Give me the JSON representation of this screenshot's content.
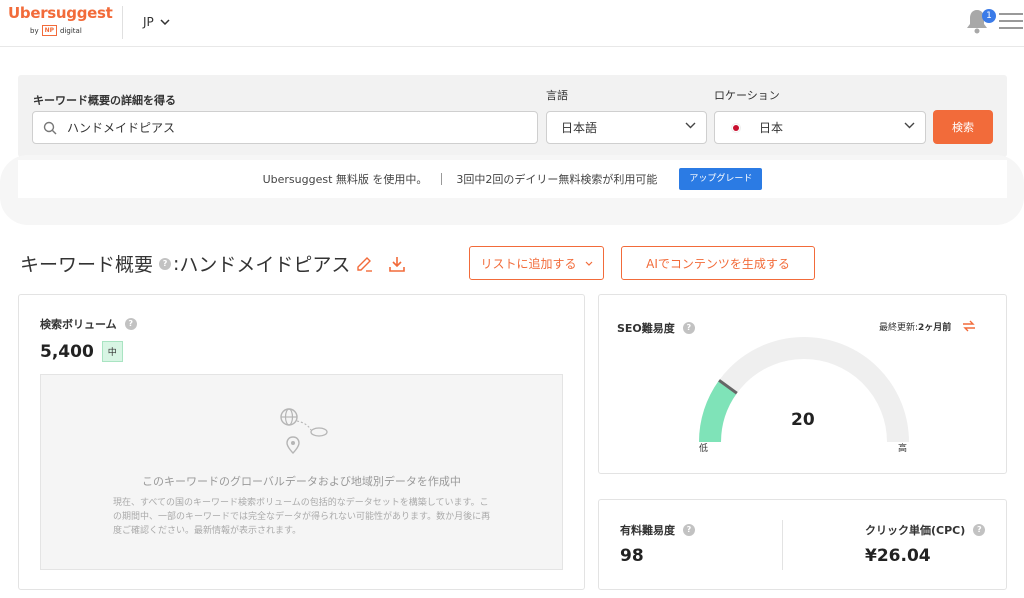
{
  "header": {
    "logo_main": "Ubersuggest",
    "logo_by": "by",
    "logo_np": "NP",
    "logo_digital": "digital",
    "lang_code": "JP",
    "notification_count": "1"
  },
  "search": {
    "keyword_label": "キーワード概要の詳細を得る",
    "keyword_value": "ハンドメイドピアス",
    "language_label": "言語",
    "language_value": "日本語",
    "location_label": "ロケーション",
    "location_value": "日本",
    "search_button": "検索"
  },
  "free_bar": {
    "plan_text": "Ubersuggest 無料版 を使用中。",
    "quota_text": "3回中2回のデイリー無料検索が利用可能",
    "upgrade_button": "アップグレード"
  },
  "overview": {
    "title_prefix": "キーワード概要",
    "title_keyword": "ハンドメイドピアス",
    "add_to_list_button": "リストに追加する",
    "ai_button": "AIでコンテンツを生成する"
  },
  "volume_card": {
    "title": "検索ボリューム",
    "value": "5,400",
    "level_badge": "中",
    "placeholder_title": "このキーワードのグローバルデータおよび地域別データを作成中",
    "placeholder_desc": "現在、すべての国のキーワード検索ボリュームの包括的なデータセットを構築しています。この期間中、一部のキーワードでは完全なデータが得られない可能性があります。数か月後に再度ご確認ください。最新情報が表示されます。"
  },
  "seo_card": {
    "title": "SEO難易度",
    "updated_label": "最終更新: ",
    "updated_value": "2ヶ月前",
    "score": "20",
    "score_fraction": 0.2,
    "low_label": "低",
    "high_label": "高",
    "gauge_color": "#7fe3b8"
  },
  "paid_card": {
    "title": "有料難易度",
    "value": "98"
  },
  "cpc_card": {
    "title": "クリック単価(CPC)",
    "value": "¥26.04"
  },
  "colors": {
    "accent": "#f26b3a",
    "upgrade": "#2b7be4"
  }
}
